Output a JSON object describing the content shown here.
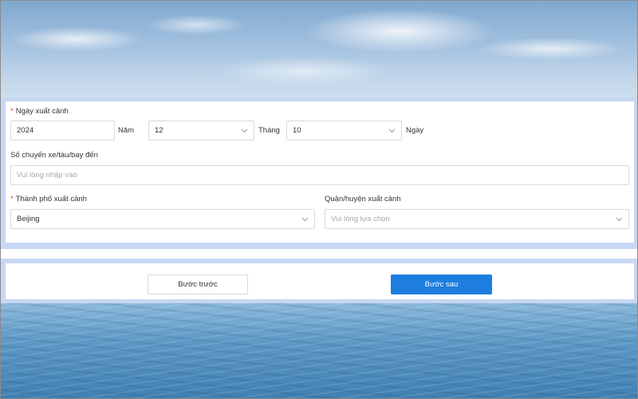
{
  "form": {
    "departure_date": {
      "label": "Ngày xuất cảnh",
      "year_value": "2024",
      "year_unit": "Năm",
      "month_value": "12",
      "month_unit": "Tháng",
      "day_value": "10",
      "day_unit": "Ngày"
    },
    "flight_number": {
      "label": "Số chuyến xe/tàu/bay đến",
      "placeholder": "Vui lòng nhập vào",
      "value": ""
    },
    "departure_city": {
      "label": "Thành phố xuất cảnh",
      "value": "Beijing"
    },
    "departure_district": {
      "label": "Quận/huyện xuất cảnh",
      "placeholder": "Vui lòng lựa chọn"
    },
    "required_mark": "*"
  },
  "actions": {
    "prev_label": "Bước trước",
    "next_label": "Bước sau"
  },
  "colors": {
    "accent": "#1d7ee0",
    "required": "#e0383e",
    "band": "#c7d7f4"
  },
  "icons": {
    "select_arrow": "chevron-down-icon"
  }
}
